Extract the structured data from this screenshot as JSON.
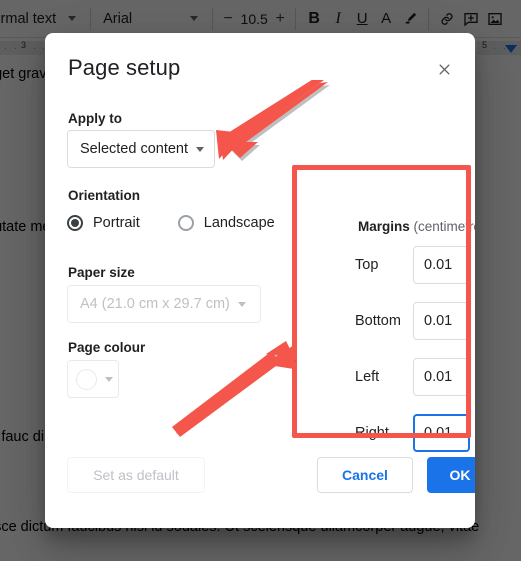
{
  "app": {
    "toolbar": {
      "style_name": "Normal text",
      "font_name": "Arial",
      "font_size": "10.5",
      "decrease_label": "−",
      "increase_label": "+",
      "bold_label": "B",
      "italic_label": "I",
      "underline_label": "U",
      "text_colour_label": "A",
      "highlight_icon": "highlight-pen-icon",
      "link_icon": "link-icon",
      "comment_icon": "add-comment-icon",
      "image_icon": "insert-image-icon"
    },
    "ruler": {
      "left_number": "3",
      "right_number": "5",
      "tick": "·",
      "indent_marker": "indent-marker-icon"
    },
    "document": {
      "paragraph_1": "eget gravida quam sem lectus etium nibh imperdiet lectus nunc pellentes",
      "paragraph_2": "putate metus. Etiam msan, t vitae ante",
      "paragraph_3": "in fauc dimentu um ut c",
      "paragraph_bottom": "usce dictum faucibus nisi id sodales. Ut scelerisque ullamcorper augue, vitae"
    }
  },
  "dialog": {
    "title": "Page setup",
    "close_icon": "close-icon",
    "apply_to": {
      "label": "Apply to",
      "value": "Selected content",
      "chevron_icon": "chevron-down-icon"
    },
    "orientation": {
      "label": "Orientation",
      "options": [
        {
          "label": "Portrait",
          "selected": true
        },
        {
          "label": "Landscape",
          "selected": false
        }
      ]
    },
    "paper_size": {
      "label": "Paper size",
      "value": "A4 (21.0 cm x 29.7 cm)",
      "chevron_icon": "chevron-down-icon",
      "disabled": true
    },
    "page_colour": {
      "label": "Page colour",
      "swatch_value": "#ffffff",
      "chevron_icon": "chevron-down-icon",
      "disabled": true
    },
    "margins": {
      "label": "Margins",
      "units": "(centimetres)",
      "fields": [
        {
          "label": "Top",
          "value": "0.01",
          "focused": false
        },
        {
          "label": "Bottom",
          "value": "0.01",
          "focused": false
        },
        {
          "label": "Left",
          "value": "0.01",
          "focused": false
        },
        {
          "label": "Right",
          "value": "0.01",
          "focused": true
        }
      ]
    },
    "footer": {
      "set_as_default": "Set as default",
      "cancel": "Cancel",
      "ok": "OK"
    }
  },
  "annotations": {
    "highlight_colour": "#F4564B",
    "arrow_1": "arrow-pointing-to-apply-to-dropdown",
    "arrow_2": "arrow-pointing-to-margins-box",
    "box_1": "highlight-box-around-margins"
  }
}
